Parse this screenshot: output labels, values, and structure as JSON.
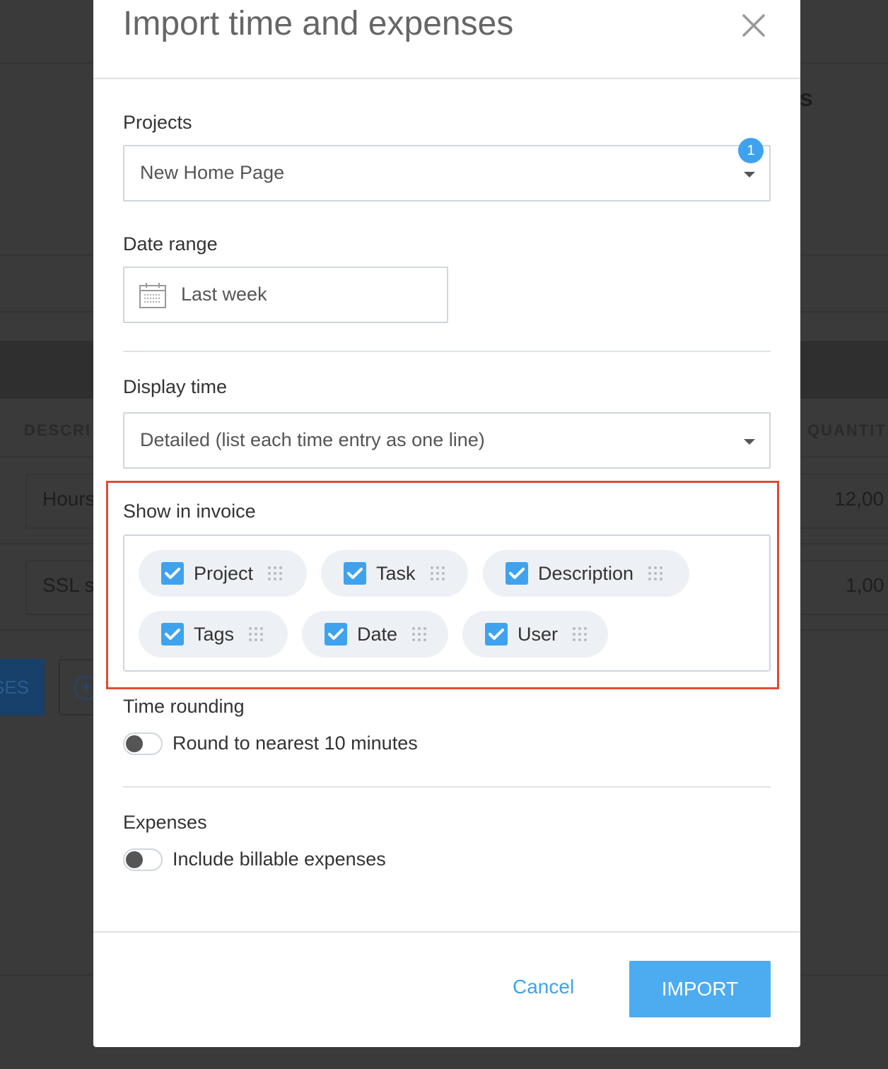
{
  "background": {
    "heading_fragment": "es",
    "col_description": "DESCRI",
    "col_quantity": "QUANTIT",
    "rows": [
      {
        "description": "Hours",
        "quantity": "12,00"
      },
      {
        "description": "SSL s",
        "quantity": "1,00"
      }
    ],
    "button_fragment": "SES"
  },
  "modal": {
    "title": "Import time and expenses",
    "close_icon": "close-icon",
    "projects": {
      "label": "Projects",
      "value": "New Home Page",
      "count_badge": "1"
    },
    "date_range": {
      "label": "Date range",
      "value": "Last week",
      "icon": "calendar-icon"
    },
    "display_time": {
      "label": "Display time",
      "value": "Detailed (list each time entry as one line)"
    },
    "show_in_invoice": {
      "label": "Show in invoice",
      "items": [
        {
          "label": "Project",
          "checked": true
        },
        {
          "label": "Task",
          "checked": true
        },
        {
          "label": "Description",
          "checked": true
        },
        {
          "label": "Tags",
          "checked": true
        },
        {
          "label": "Date",
          "checked": true
        },
        {
          "label": "User",
          "checked": true
        }
      ]
    },
    "time_rounding": {
      "label": "Time rounding",
      "toggle_label": "Round to nearest 10 minutes",
      "enabled": false
    },
    "expenses": {
      "label": "Expenses",
      "toggle_label": "Include billable expenses",
      "enabled": false
    },
    "footer": {
      "cancel_label": "Cancel",
      "import_label": "IMPORT"
    }
  },
  "colors": {
    "accent": "#3fa2ee",
    "highlight_border": "#e04b36",
    "overlay": "#3a3a3a"
  }
}
